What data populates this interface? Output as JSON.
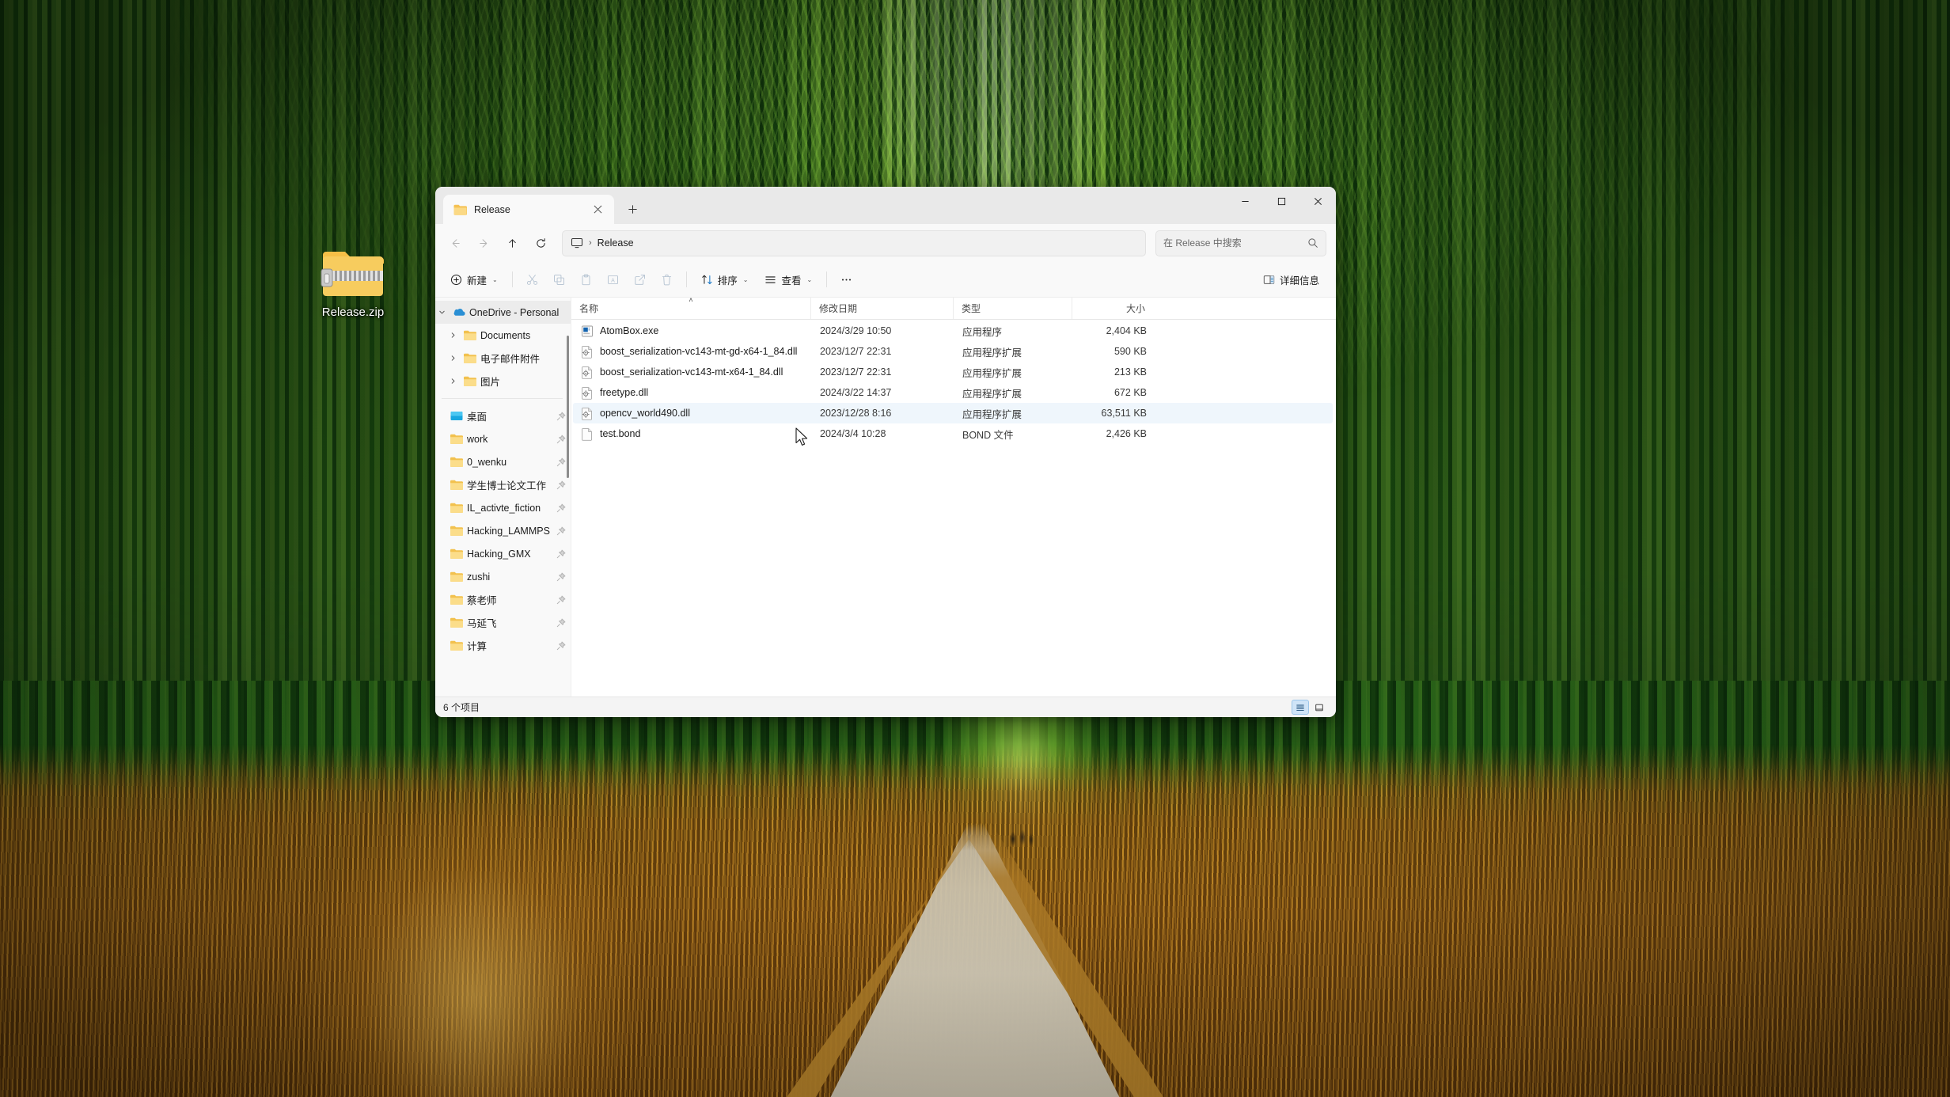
{
  "desktop": {
    "wallpaper_name": "bamboo-forest-path",
    "icon": {
      "name": "zip-folder-icon",
      "label": "Release.zip"
    }
  },
  "window": {
    "tab": {
      "title": "Release",
      "folder_icon": "folder-icon",
      "close_icon": "close-icon"
    },
    "new_tab_icon": "plus-icon",
    "controls": {
      "minimize": "—",
      "maximize": "☐",
      "close": "✕"
    }
  },
  "nav": {
    "back_icon": "arrow-left-icon",
    "forward_icon": "arrow-right-icon",
    "up_icon": "arrow-up-icon",
    "refresh_icon": "refresh-icon",
    "breadcrumb": {
      "root_icon": "this-pc-icon",
      "separator": "›",
      "current": "Release"
    }
  },
  "search": {
    "placeholder": "在 Release 中搜索",
    "value": "",
    "icon": "search-icon"
  },
  "toolbar": {
    "new_label": "新建",
    "new_icon": "plus-circle-icon",
    "cut_icon": "scissors-icon",
    "copy_icon": "copy-icon",
    "paste_icon": "paste-icon",
    "rename_icon": "rename-icon",
    "share_icon": "share-icon",
    "delete_icon": "trash-icon",
    "sort_label": "排序",
    "sort_icon": "sort-icon",
    "view_label": "查看",
    "view_icon": "view-list-icon",
    "more_icon": "ellipsis-icon",
    "details_label": "详细信息",
    "details_icon": "details-pane-icon",
    "caret": "⌄"
  },
  "sidebar": {
    "root": {
      "label": "OneDrive - Personal",
      "icon": "onedrive-icon",
      "expanded": true
    },
    "children": [
      {
        "label": "Documents",
        "icon": "folder-icon",
        "chevron": "›"
      },
      {
        "label": "电子邮件附件",
        "icon": "folder-icon",
        "chevron": "›"
      },
      {
        "label": "图片",
        "icon": "folder-icon",
        "chevron": "›"
      }
    ],
    "pinned": [
      {
        "label": "桌面",
        "icon": "desktop-icon",
        "pin": "pin-icon"
      },
      {
        "label": "work",
        "icon": "folder-icon",
        "pin": "pin-icon"
      },
      {
        "label": "0_wenku",
        "icon": "folder-icon",
        "pin": "pin-icon"
      },
      {
        "label": "学生博士论文工作",
        "icon": "folder-icon",
        "pin": "pin-icon"
      },
      {
        "label": "IL_activte_fiction",
        "icon": "folder-icon",
        "pin": "pin-icon"
      },
      {
        "label": "Hacking_LAMMPS",
        "icon": "folder-icon",
        "pin": "pin-icon"
      },
      {
        "label": "Hacking_GMX",
        "icon": "folder-icon",
        "pin": "pin-icon"
      },
      {
        "label": "zushi",
        "icon": "folder-icon",
        "pin": "pin-icon"
      },
      {
        "label": "蔡老师",
        "icon": "folder-icon",
        "pin": "pin-icon"
      },
      {
        "label": "马延飞",
        "icon": "folder-icon",
        "pin": "pin-icon"
      },
      {
        "label": "计算",
        "icon": "folder-icon",
        "pin": "pin-icon"
      }
    ]
  },
  "filelist": {
    "columns": [
      {
        "key": "name",
        "label": "名称",
        "sorted": "asc",
        "sort_caret": "˄"
      },
      {
        "key": "date",
        "label": "修改日期"
      },
      {
        "key": "type",
        "label": "类型"
      },
      {
        "key": "size",
        "label": "大小"
      }
    ],
    "rows": [
      {
        "name": "AtomBox.exe",
        "date": "2024/3/29 10:50",
        "type": "应用程序",
        "size": "2,404 KB",
        "icon": "exe-icon",
        "selected": false
      },
      {
        "name": "boost_serialization-vc143-mt-gd-x64-1_84.dll",
        "date": "2023/12/7 22:31",
        "type": "应用程序扩展",
        "size": "590 KB",
        "icon": "dll-icon",
        "selected": false
      },
      {
        "name": "boost_serialization-vc143-mt-x64-1_84.dll",
        "date": "2023/12/7 22:31",
        "type": "应用程序扩展",
        "size": "213 KB",
        "icon": "dll-icon",
        "selected": false
      },
      {
        "name": "freetype.dll",
        "date": "2024/3/22 14:37",
        "type": "应用程序扩展",
        "size": "672 KB",
        "icon": "dll-icon",
        "selected": false
      },
      {
        "name": "opencv_world490.dll",
        "date": "2023/12/28 8:16",
        "type": "应用程序扩展",
        "size": "63,511 KB",
        "icon": "dll-icon",
        "selected": true
      },
      {
        "name": "test.bond",
        "date": "2024/3/4 10:28",
        "type": "BOND 文件",
        "size": "2,426 KB",
        "icon": "file-icon",
        "selected": false
      }
    ]
  },
  "statusbar": {
    "count_label": "6 个项目",
    "details_view_icon": "details-view-icon",
    "large_icons_view_icon": "large-icons-view-icon"
  },
  "colors": {
    "accent": "#0078d4",
    "selection": "#eff6fc",
    "window_bg": "#f9f9f9",
    "titlebar_bg": "#e9e9e9",
    "folder_yellow": "#f7c95c"
  }
}
